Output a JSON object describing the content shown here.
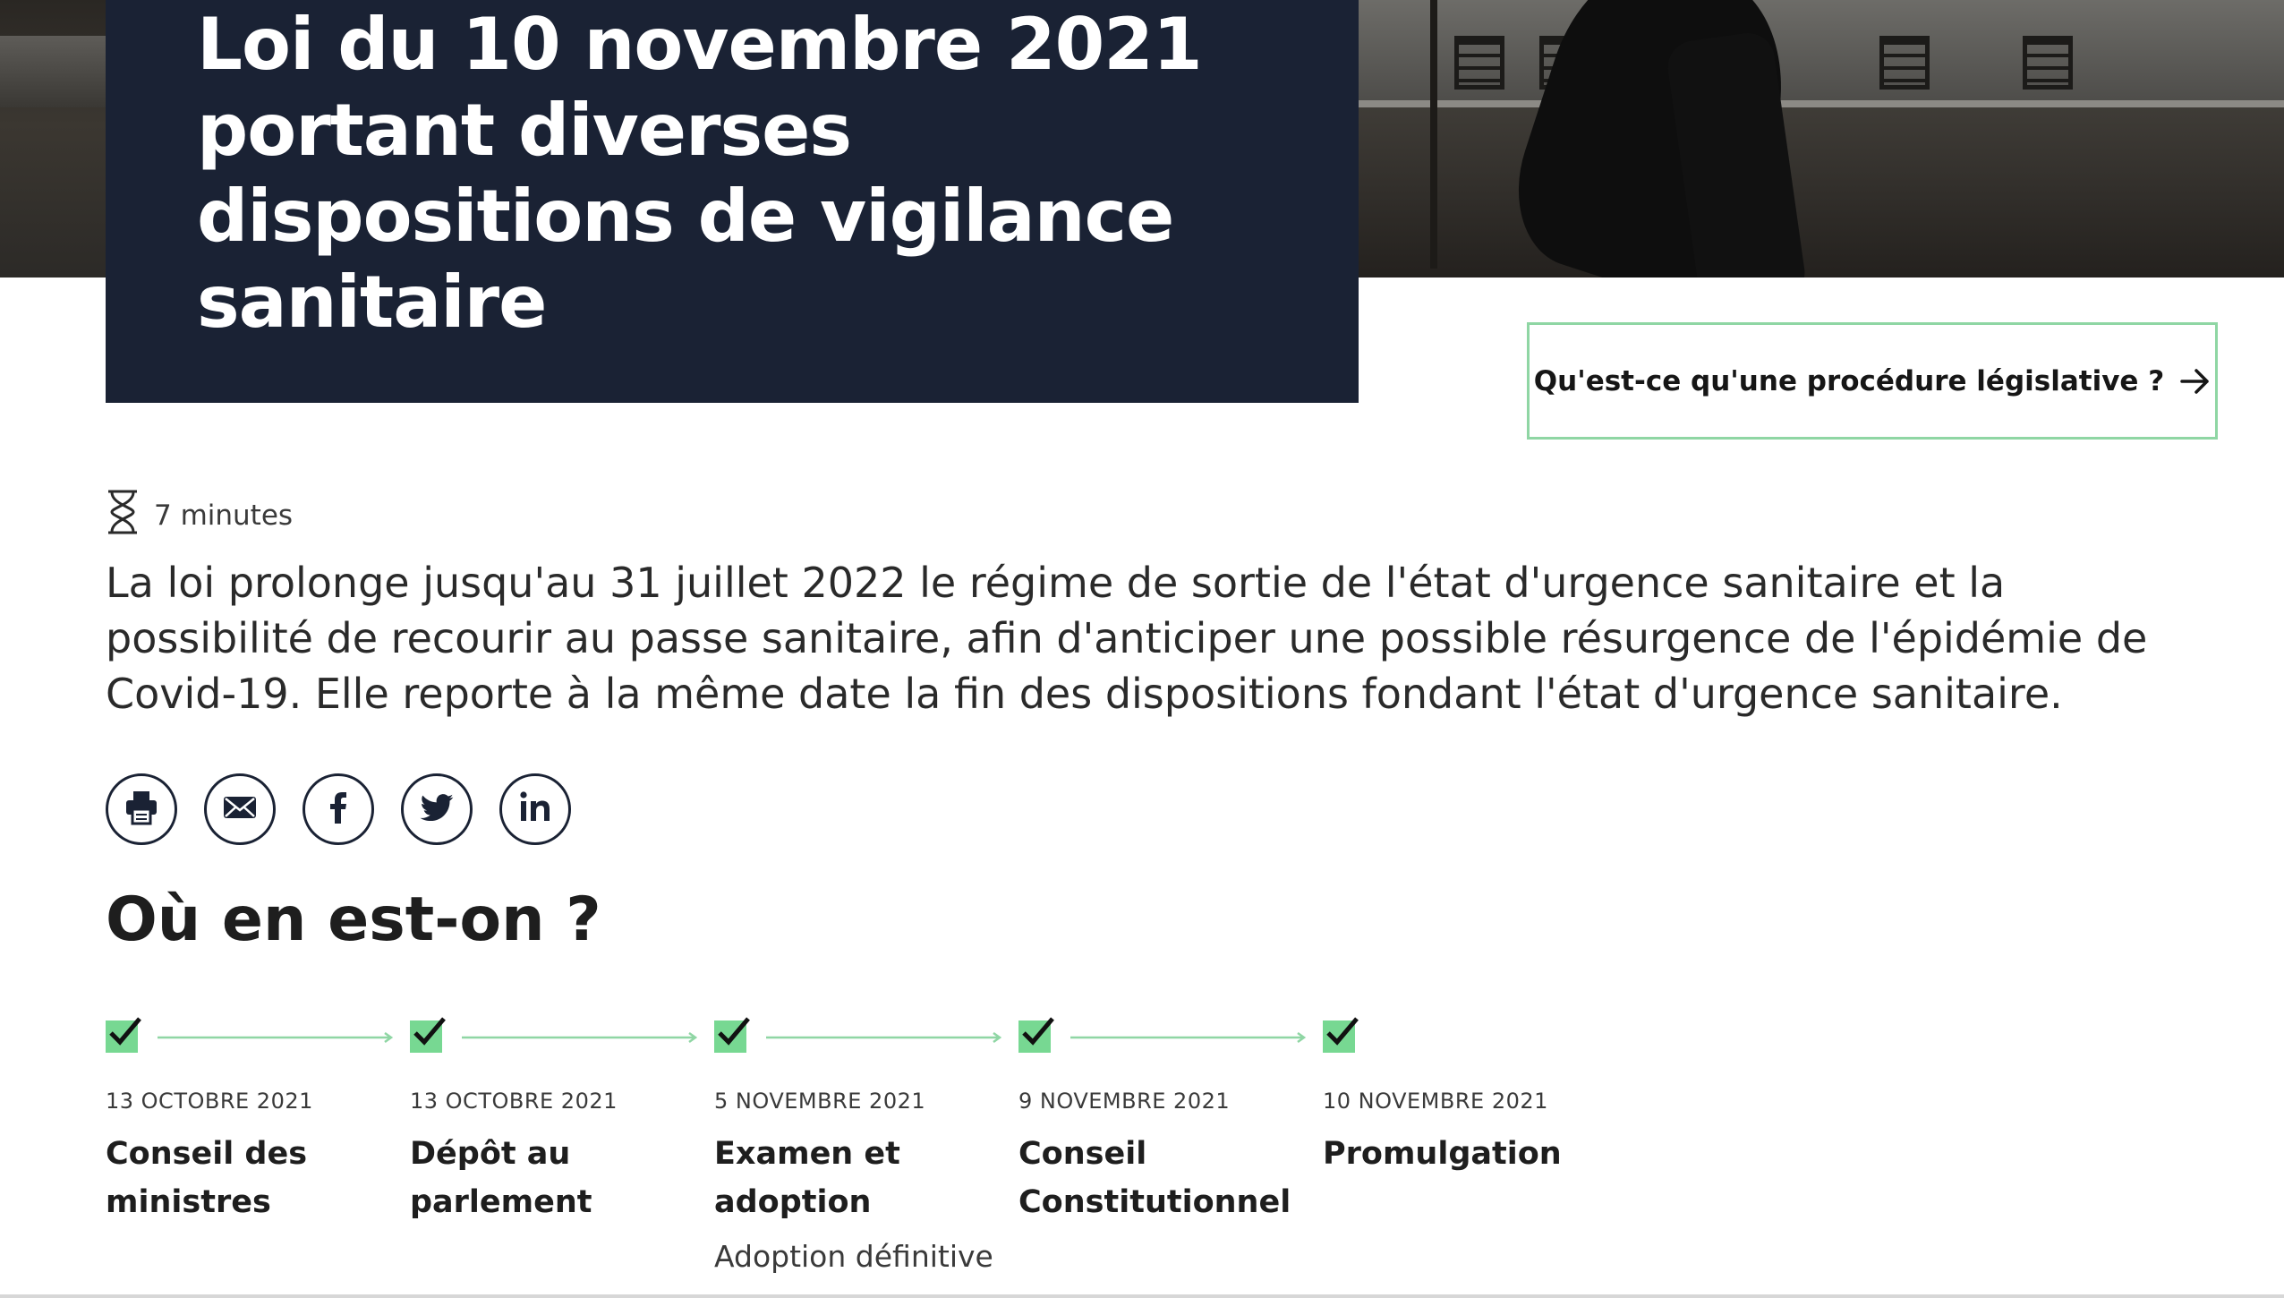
{
  "hero": {
    "title": "Loi du 10 novembre 2021 portant diverses dispositions de vigilance sanitaire"
  },
  "procedure_button": {
    "label": "Qu'est-ce qu'une procédure législative ?",
    "icon": "arrow-right-icon"
  },
  "reading_time": {
    "icon": "hourglass-icon",
    "label": "7 minutes"
  },
  "lead": "La loi prolonge jusqu'au 31 juillet 2022 le régime de sortie de l'état d'urgence sanitaire et la possibilité de recourir au passe sanitaire, afin d'anticiper une possible résurgence de l'épidémie de Covid-19. Elle reporte à la même date la fin des dispositions fondant l'état d'urgence sanitaire.",
  "share": [
    {
      "name": "print",
      "icon": "print-icon"
    },
    {
      "name": "email",
      "icon": "email-icon"
    },
    {
      "name": "facebook",
      "icon": "facebook-icon"
    },
    {
      "name": "twitter",
      "icon": "twitter-icon"
    },
    {
      "name": "linkedin",
      "icon": "linkedin-icon"
    }
  ],
  "section": {
    "title": "Où en est-on ?"
  },
  "timeline": [
    {
      "date": "13 OCTOBRE 2021",
      "title_lines": [
        "Conseil des",
        "ministres"
      ],
      "subtitle": "",
      "done": true
    },
    {
      "date": "13 OCTOBRE 2021",
      "title_lines": [
        "Dépôt au",
        "parlement"
      ],
      "subtitle": "",
      "done": true
    },
    {
      "date": "5 NOVEMBRE 2021",
      "title_lines": [
        "Examen et",
        "adoption"
      ],
      "subtitle": "Adoption définitive",
      "done": true
    },
    {
      "date": "9 NOVEMBRE 2021",
      "title_lines": [
        "Conseil",
        "Constitutionnel"
      ],
      "subtitle": "",
      "done": true
    },
    {
      "date": "10 NOVEMBRE 2021",
      "title_lines": [
        "Promulgation"
      ],
      "subtitle": "",
      "done": true
    }
  ],
  "colors": {
    "navy": "#1a2234",
    "green": "#77d892",
    "green_border": "#8fd6a4"
  }
}
